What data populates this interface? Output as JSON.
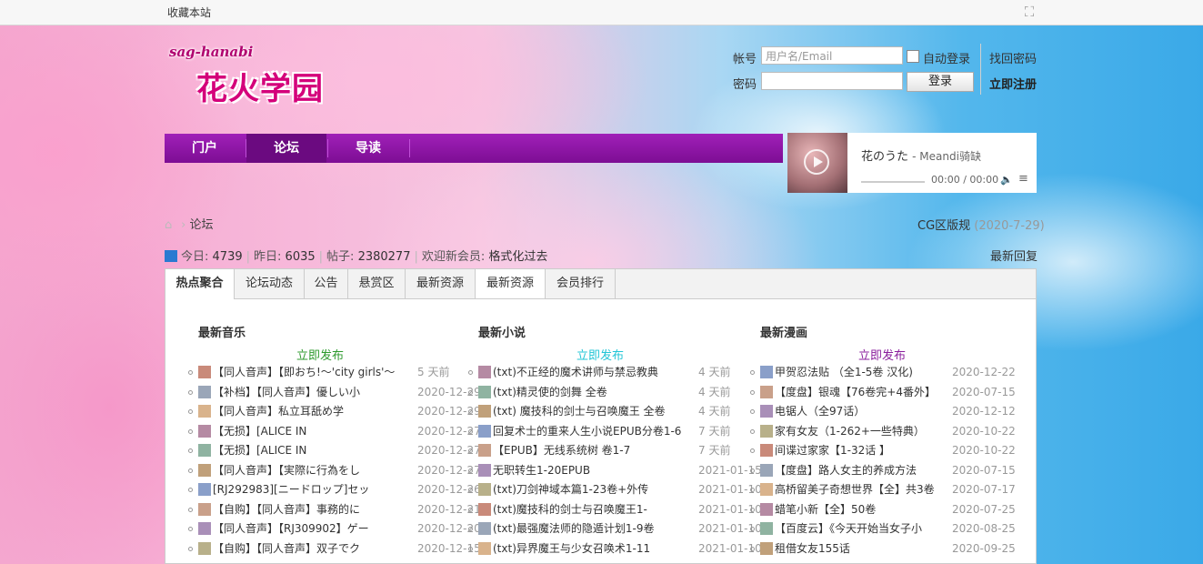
{
  "topbar": {
    "favorite": "收藏本站",
    "expand_icon": "expand-icon"
  },
  "logo": {
    "roman": "sag-hanabi",
    "text": "花火学园"
  },
  "login": {
    "account_label": "帐号",
    "account_placeholder": "用户名/Email",
    "password_label": "密码",
    "auto_login": "自动登录",
    "login_button": "登录",
    "find_password": "找回密码",
    "register": "立即注册"
  },
  "nav": {
    "items": [
      {
        "label": "门户"
      },
      {
        "label": "论坛"
      },
      {
        "label": "导读"
      }
    ]
  },
  "player": {
    "title": "花のうた",
    "artist": "- Meandi骑缺",
    "time": "00:00 / 00:00"
  },
  "breadcrumb": {
    "current": "论坛"
  },
  "cg": {
    "label": "CG区版规",
    "date": "(2020-7-29)"
  },
  "stats": {
    "today_label": "今日:",
    "today": "4739",
    "yesterday_label": "昨日:",
    "yesterday": "6035",
    "posts_label": "帖子:",
    "posts": "2380277",
    "welcome_label": "欢迎新会员:",
    "new_member": "格式化过去"
  },
  "latest_reply": "最新回复",
  "tabs": [
    {
      "label": "热点聚合"
    },
    {
      "label": "论坛动态"
    },
    {
      "label": "公告"
    },
    {
      "label": "悬赏区"
    },
    {
      "label": "最新资源"
    },
    {
      "label": "最新资源"
    },
    {
      "label": "会员排行"
    }
  ],
  "columns": [
    {
      "title": "最新音乐",
      "post": "立即发布",
      "post_color": "#2e9a2e",
      "rows": [
        {
          "title": "【同人音声】【即おち!～'city girls'～",
          "date": "5 天前"
        },
        {
          "title": "【补档】【同人音声】優しい小",
          "date": "2020-12-29"
        },
        {
          "title": "【同人音声】私立耳舐め学",
          "date": "2020-12-29"
        },
        {
          "title": "【无损】[ALICE IN",
          "date": "2020-12-27"
        },
        {
          "title": "【无损】[ALICE IN",
          "date": "2020-12-27"
        },
        {
          "title": "【同人音声】【実際に行為をし",
          "date": "2020-12-27"
        },
        {
          "title": "[RJ292983][ニードロップ]セッ",
          "date": "2020-12-26"
        },
        {
          "title": "【自购】【同人音声】事務的に",
          "date": "2020-12-21"
        },
        {
          "title": "【同人音声】【RJ309902】ゲー",
          "date": "2020-12-20"
        },
        {
          "title": "【自购】【同人音声】双子でク",
          "date": "2020-12-15"
        }
      ]
    },
    {
      "title": "最新小说",
      "post": "立即发布",
      "post_color": "#22c5d6",
      "rows": [
        {
          "title": "(txt)不正经的魔术讲师与禁忌教典",
          "date": "4 天前"
        },
        {
          "title": "(txt)精灵使的剑舞 全卷",
          "date": "4 天前"
        },
        {
          "title": "(txt) 魔技科的剑士与召唤魔王 全卷",
          "date": "4 天前"
        },
        {
          "title": "回复术士的重来人生小说EPUB分卷1-6",
          "date": "7 天前"
        },
        {
          "title": "【EPUB】无线系统树 卷1-7",
          "date": "7 天前"
        },
        {
          "title": "无职转生1-20EPUB",
          "date": "2021-01-15"
        },
        {
          "title": "(txt)刀剑神域本篇1-23卷+外传",
          "date": "2021-01-10"
        },
        {
          "title": "(txt)魔技科的剑士与召唤魔王1-",
          "date": "2021-01-10"
        },
        {
          "title": "(txt)最强魔法师的隐遁计划1-9卷",
          "date": "2021-01-10"
        },
        {
          "title": "(txt)异界魔王与少女召唤术1-11",
          "date": "2021-01-10"
        }
      ]
    },
    {
      "title": "最新漫画",
      "post": "立即发布",
      "post_color": "#8a1e9c",
      "rows": [
        {
          "title": "甲贺忍法贴 （全1-5卷 汉化)",
          "date": "2020-12-22"
        },
        {
          "title": "【度盘】银魂【76卷完+4番外】",
          "date": "2020-07-15"
        },
        {
          "title": "电锯人（全97话）",
          "date": "2020-12-12"
        },
        {
          "title": "家有女友（1-262+一些特典）",
          "date": "2020-10-22"
        },
        {
          "title": "间谍过家家【1-32话 】",
          "date": "2020-10-22"
        },
        {
          "title": "【度盘】路人女主的养成方法",
          "date": "2020-07-15"
        },
        {
          "title": "高桥留美子奇想世界【全】共3卷",
          "date": "2020-07-17"
        },
        {
          "title": "蜡笔小新【全】50卷",
          "date": "2020-07-25"
        },
        {
          "title": "【百度云】《今天开始当女子小",
          "date": "2020-08-25"
        },
        {
          "title": "租借女友155话",
          "date": "2020-09-25"
        }
      ]
    }
  ]
}
